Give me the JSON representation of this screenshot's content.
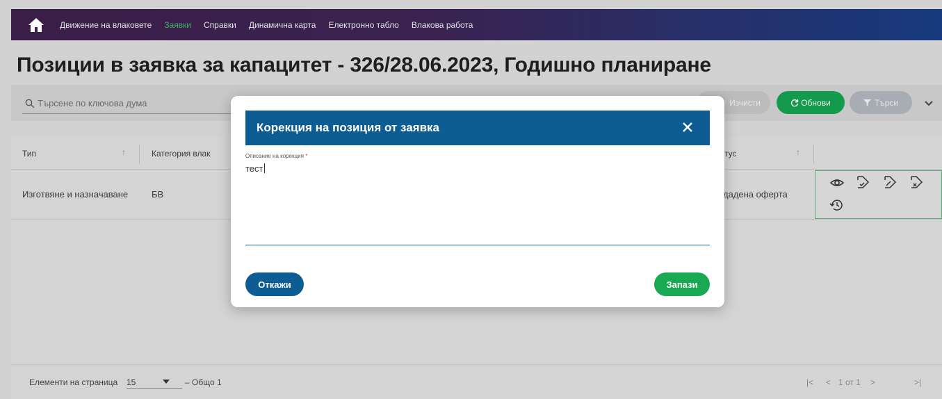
{
  "nav": {
    "home_icon": "home-icon",
    "items": [
      {
        "label": "Движение на влаковете",
        "active": false
      },
      {
        "label": "Заявки",
        "active": true
      },
      {
        "label": "Справки",
        "active": false
      },
      {
        "label": "Динамична карта",
        "active": false
      },
      {
        "label": "Електронно табло",
        "active": false
      },
      {
        "label": "Влакова работа",
        "active": false
      }
    ],
    "active_color": "#3bb26a"
  },
  "page": {
    "title": "Позиции в заявка за капацитет - 326/28.06.2023, Годишно планиране"
  },
  "toolbar": {
    "search_placeholder": "Търсене по ключова дума",
    "clear_label": "Изчисти",
    "refresh_label": "Обнови",
    "search_label": "Търси",
    "refresh_color": "#149a4c"
  },
  "table": {
    "columns": [
      "Тип",
      "Категория влак",
      "тус"
    ],
    "rows": [
      {
        "type": "Изготвяне и назначаване",
        "category": "БВ",
        "status": "дадена оферта"
      }
    ],
    "row_actions": [
      "eye-icon",
      "tag-check-icon",
      "tag-edit-icon",
      "tag-remove-icon",
      "history-icon"
    ]
  },
  "footer": {
    "per_page_label": "Елементи на страница",
    "per_page_value": "15",
    "total": "– Общо 1",
    "page_info": "1 от 1"
  },
  "modal": {
    "title": "Корекция на позиция от заявка",
    "field_label": "Описание на корекция",
    "required_mark": "*",
    "field_value": "тест",
    "cancel_label": "Откажи",
    "save_label": "Запази",
    "header_color": "#0d5d94",
    "save_color": "#19a952"
  }
}
